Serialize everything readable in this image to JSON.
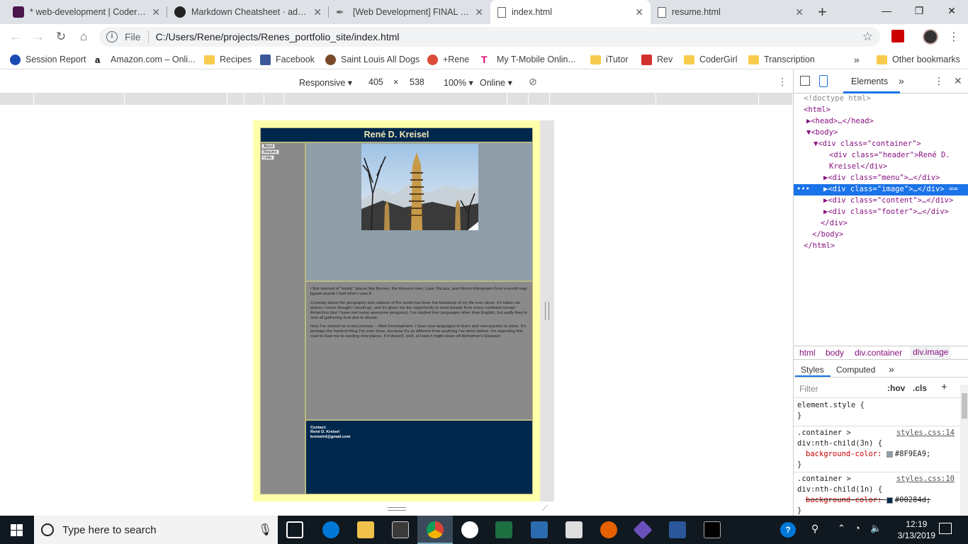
{
  "browser": {
    "tabs": [
      {
        "title": "* web-development | CoderGir",
        "icon": "slack-icon",
        "color": "#4a154b"
      },
      {
        "title": "Markdown Cheatsheet · adam",
        "icon": "github-icon",
        "color": "#222222"
      },
      {
        "title": "[Web Development] FINAL SU",
        "icon": "quill-icon",
        "color": "#888888"
      },
      {
        "title": "index.html",
        "icon": "page-icon",
        "color": "#5f6368",
        "active": true
      },
      {
        "title": "resume.html",
        "icon": "page-icon",
        "color": "#5f6368"
      }
    ],
    "new_tab": "+",
    "window_controls": {
      "minimize": "—",
      "restore": "❐",
      "close": "✕"
    },
    "address": {
      "scheme_label": "File",
      "url": "C:/Users/Rene/projects/Renes_portfolio_site/index.html"
    },
    "bookmarks": [
      {
        "label": "Session Report",
        "icon": "session-icon"
      },
      {
        "label": "Amazon.com – Onli...",
        "icon": "amazon-icon"
      },
      {
        "label": "Recipes",
        "icon": "folder-icon"
      },
      {
        "label": "Facebook",
        "icon": "facebook-icon"
      },
      {
        "label": "Saint Louis All Dogs",
        "icon": "paw-icon"
      },
      {
        "label": "+Rene",
        "icon": "google-plus-icon"
      },
      {
        "label": "My T-Mobile Onlin...",
        "icon": "tmobile-icon"
      },
      {
        "label": "iTutor",
        "icon": "folder-icon"
      },
      {
        "label": "Rev",
        "icon": "rev-icon"
      },
      {
        "label": "CoderGirl",
        "icon": "folder-icon"
      },
      {
        "label": "Transcription",
        "icon": "folder-icon"
      }
    ],
    "bookmarks_overflow": "»",
    "other_bookmarks": "Other bookmarks"
  },
  "device_toolbar": {
    "mode": "Responsive",
    "width": "405",
    "times": "×",
    "height": "538",
    "zoom": "100%",
    "network": "Online"
  },
  "emulated_page": {
    "header": "René D. Kreisel",
    "menu": [
      "About",
      "Resume",
      "Links"
    ],
    "content_paragraphs": [
      "I first learned of \"exotic\" places like Borneo, the Amazon river, Lake Titicaca, and Mount Kilimanjaro from a world map jigsaw puzzle I had when I was 8.",
      "Curiosity about the geography and cultures of the world has been the backdrop of my life ever since. It's taken me places I never thought I would go, and it's given me the opportunity to meet people from every continent except Antarctica (but I have met some awesome penguins). I've studied four languages other than English, but sadly they're now all gathering dust due to disuse.",
      "Now I've started on a new journey -- Web Development. I have new languages to learn and new puzzles to solve. It's perhaps the hardest thing I've ever done, because it's so different from anything I've done before. I'm expecting this road to lead me to exciting new places. If it doesn't, well, at least it might stave off Alzheimer's Disease!"
    ],
    "footer": [
      "Contact:",
      "René D. Kreisel",
      "kreiselrd@gmail.com"
    ],
    "colors": {
      "frame": "#ffffaa",
      "header": "#00284d",
      "image_bg": "#8F9EA9",
      "menu": "#8a8a8a"
    }
  },
  "devtools": {
    "panel_tab": "Elements",
    "more": "»",
    "dom": [
      {
        "t": "<!doctype html>"
      },
      {
        "t": "<html>"
      },
      {
        "t": "▶<head>…</head>"
      },
      {
        "t": "▼<body>"
      },
      {
        "t": "▼<div class=\"container\">"
      },
      {
        "t": "<div class=\"header\">René D."
      },
      {
        "t": "Kreisel</div>"
      },
      {
        "t": "▶<div class=\"menu\">…</div>"
      },
      {
        "t": "▶<div class=\"image\">…</div> =="
      },
      {
        "t": "▶<div class=\"content\">…</div>"
      },
      {
        "t": "▶<div class=\"footer\">…</div>"
      },
      {
        "t": "</div>"
      },
      {
        "t": "</body>"
      },
      {
        "t": "</html>"
      }
    ],
    "breadcrumbs": [
      "html",
      "body",
      "div.container",
      "div.image"
    ],
    "styles_tabs": [
      "Styles",
      "Computed"
    ],
    "filter_placeholder": "Filter",
    "filter_buttons": [
      ":hov",
      ".cls",
      "+"
    ],
    "rules": [
      {
        "selector": "element.style {",
        "close": "}"
      },
      {
        "selector": ".container >",
        "selector2": "div:nth-child(3n) {",
        "source": "styles.css:14",
        "prop": "background-color:",
        "value": "#8F9EA9;",
        "close": "}"
      },
      {
        "selector": ".container >",
        "selector2": "div:nth-child(1n) {",
        "source": "styles.css:10",
        "prop": "background-color:",
        "value": "#00284d;",
        "close": "}"
      }
    ]
  },
  "taskbar": {
    "search_placeholder": "Type here to search",
    "time": "12:19",
    "date": "3/13/2019"
  }
}
